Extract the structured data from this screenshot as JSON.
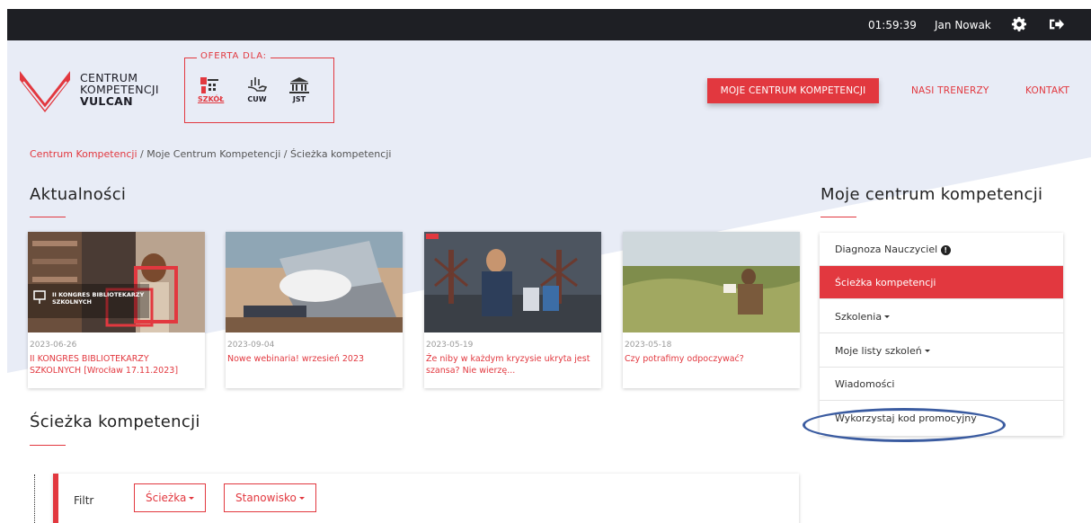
{
  "topbar": {
    "time": "01:59:39",
    "user": "Jan Nowak",
    "icons": [
      "gear-icon",
      "logout-icon"
    ]
  },
  "brand": {
    "line1": "CENTRUM",
    "line2": "KOMPETENCJI",
    "line3": "VULCAN"
  },
  "oferta": {
    "legend": "OFERTA DLA:",
    "items": [
      {
        "label": "SZKÓŁ"
      },
      {
        "label": "CUW"
      },
      {
        "label": "JST"
      }
    ]
  },
  "nav": {
    "moje": "MOJE CENTRUM KOMPETENCJI",
    "trenerzy": "NASI TRENERZY",
    "kontakt": "KONTAKT"
  },
  "breadcrumb": {
    "b1": "Centrum Kompetencji",
    "sep": "/",
    "b2": "Moje Centrum Kompetencji",
    "b3": "Ścieżka kompetencji"
  },
  "news": {
    "title": "Aktualności",
    "cards": [
      {
        "date": "2023-06-26",
        "title": "II KONGRES BIBLIOTEKARZY SZKOLNYCH [Wrocław 17.11.2023]",
        "overlay": "II KONGRES BIBLIOTEKARZY SZKOLNYCH"
      },
      {
        "date": "2023-09-04",
        "title": "Nowe webinaria! wrzesień 2023"
      },
      {
        "date": "2023-05-19",
        "title": "Że niby w każdym kryzysie ukryta jest szansa? Nie wierzę..."
      },
      {
        "date": "2023-05-18",
        "title": "Czy potrafimy odpoczywać?"
      }
    ]
  },
  "sidebar": {
    "title": "Moje centrum kompetencji",
    "items": [
      {
        "label": "Diagnoza Nauczyciel"
      },
      {
        "label": "Ścieżka kompetencji"
      },
      {
        "label": "Szkolenia"
      },
      {
        "label": "Moje listy szkoleń"
      },
      {
        "label": "Wiadomości"
      },
      {
        "label": "Wykorzystaj kod promocyjny"
      }
    ]
  },
  "sciezka": {
    "title": "Ścieżka kompetencji"
  },
  "filter": {
    "label": "Filtr",
    "sciezka": "Ścieżka",
    "stanowisko": "Stanowisko"
  },
  "colors": {
    "accent": "#e2383f",
    "topbar": "#1e1f24",
    "header_bg": "#e8ecf6",
    "highlight": "#3a5ba0"
  }
}
